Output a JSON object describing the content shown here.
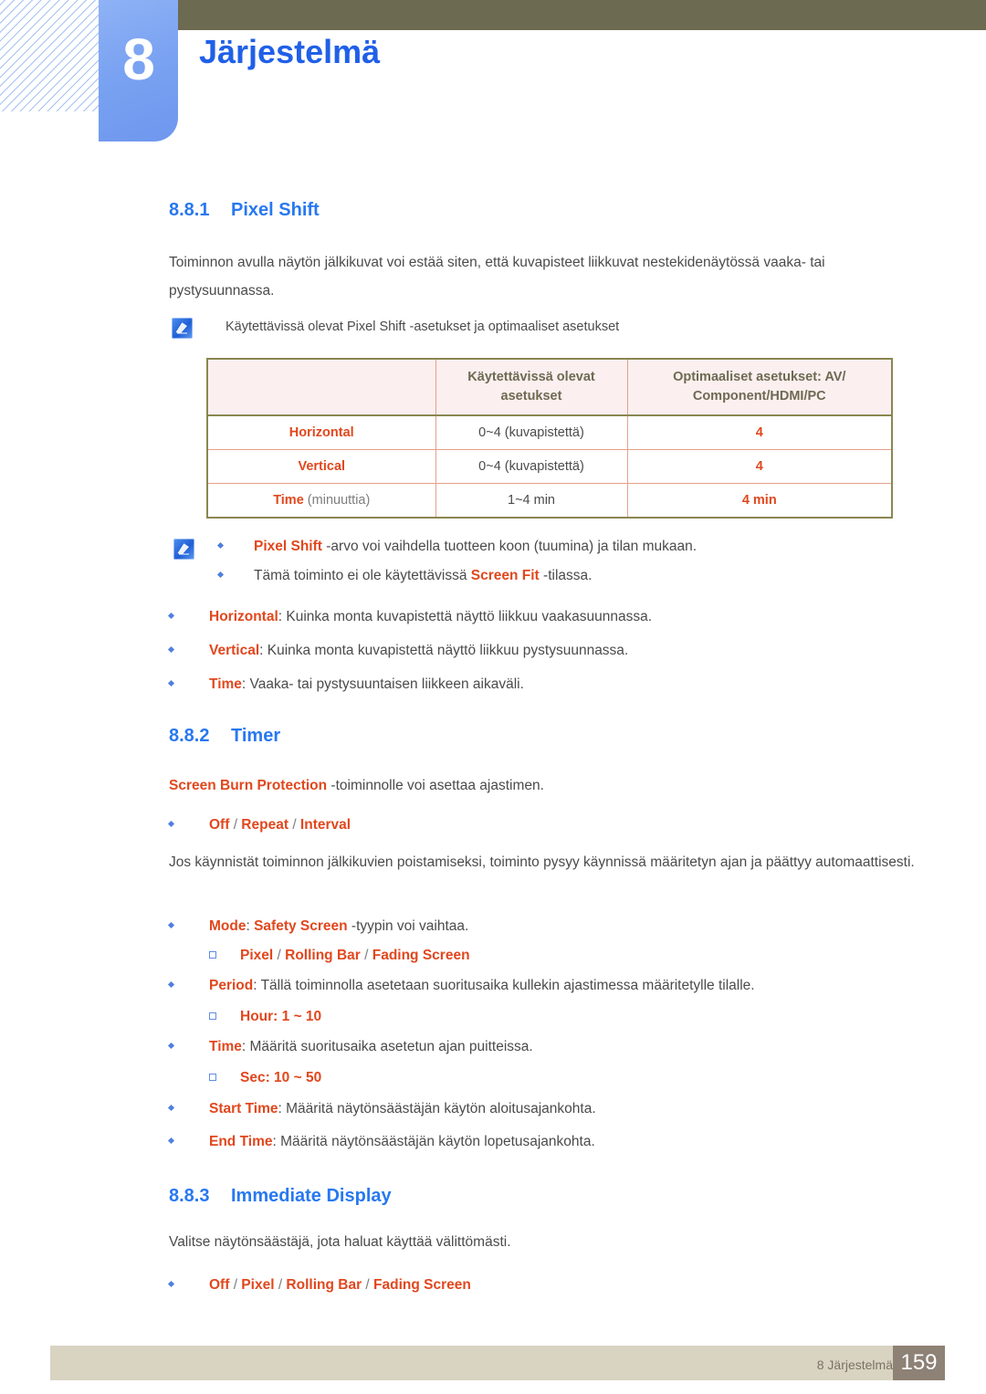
{
  "header": {
    "chapter_number": "8",
    "chapter_title": "Järjestelmä"
  },
  "sections": {
    "s1": {
      "number": "8.8.1",
      "title": "Pixel Shift",
      "body": "Toiminnon avulla näytön jälkikuvat voi estää siten, että kuvapisteet liikkuvat nestekidenäytössä vaaka- tai pystysuunnassa.",
      "note_caption": "Käytettävissä olevat Pixel Shift -asetukset ja optimaaliset asetukset"
    },
    "s2": {
      "number": "8.8.2",
      "title": "Timer",
      "intro_bold": "Screen Burn Protection",
      "intro_rest": " -toiminnolle voi asettaa ajastimen.",
      "options": "Off / Repeat / Interval",
      "body": "Jos käynnistät toiminnon jälkikuvien poistamiseksi, toiminto pysyy käynnissä määritetyn ajan ja päättyy automaattisesti."
    },
    "s3": {
      "number": "8.8.3",
      "title": "Immediate Display",
      "body": "Valitse näytönsäästäjä, jota haluat käyttää välittömästi.",
      "options": "Off / Pixel / Rolling Bar / Fading Screen"
    }
  },
  "table": {
    "columns": [
      "",
      "Käytettävissä olevat asetukset",
      "Optimaaliset asetukset: AV/ Component/HDMI/PC"
    ],
    "col_header_lines": [
      [
        "",
        ""
      ],
      [
        "Käytettävissä olevat",
        "asetukset"
      ],
      [
        "Optimaaliset asetukset: AV/",
        "Component/HDMI/PC"
      ]
    ],
    "rows": [
      {
        "key": "Horizontal",
        "key_unit": "",
        "available": "0~4 (kuvapistettä)",
        "optimal": "4"
      },
      {
        "key": "Vertical",
        "key_unit": "",
        "available": "0~4 (kuvapistettä)",
        "optimal": "4"
      },
      {
        "key": "Time",
        "key_unit": " (minuuttia)",
        "available": "1~4 min",
        "optimal": "4 min"
      }
    ]
  },
  "notes_after_table": {
    "item1_bold": "Pixel Shift",
    "item1_rest": " -arvo voi vaihdella tuotteen koon (tuumina) ja tilan mukaan.",
    "item2_pre": "Tämä toiminto ei ole käytettävissä ",
    "item2_bold": "Screen Fit",
    "item2_rest": " -tilassa."
  },
  "pixel_shift_bullets": [
    {
      "bold": "Horizontal",
      "rest": ": Kuinka monta kuvapistettä näyttö liikkuu vaakasuunnassa."
    },
    {
      "bold": "Vertical",
      "rest": ": Kuinka monta kuvapistettä näyttö liikkuu pystysuunnassa."
    },
    {
      "bold": "Time",
      "rest": ": Vaaka- tai pystysuuntaisen liikkeen aikaväli."
    }
  ],
  "timer_bullets": [
    {
      "bold": "Mode",
      "mid": ": ",
      "bold2": "Safety Screen",
      "rest": " -tyypin voi vaihtaa."
    },
    {
      "bold": "Period",
      "rest": ": Tällä toiminnolla asetetaan suoritusaika kullekin ajastimessa määritetylle tilalle."
    },
    {
      "bold": "Time",
      "rest": ": Määritä suoritusaika asetetun ajan puitteissa."
    },
    {
      "bold": "Start Time",
      "rest": ": Määritä näytönsäästäjän käytön aloitusajankohta."
    },
    {
      "bold": "End Time",
      "rest": ": Määritä näytönsäästäjän käytön lopetusajankohta."
    }
  ],
  "timer_sub_bullets": {
    "mode_options": "Pixel / Rolling Bar / Fading Screen",
    "hour_label": "Hour",
    "hour_value": ": 1 ~ 10",
    "sec_label": "Sec",
    "sec_value": ": 10 ~ 50"
  },
  "footer": {
    "text": "8 Järjestelmä",
    "page": "159"
  },
  "colors": {
    "accent_blue": "#2878f0",
    "accent_orange": "#e1471d",
    "olive": "#6d6a52",
    "table_header_bg": "#fbefef",
    "footer_band": "#d9d3c2",
    "footer_page_bg": "#8e8175"
  }
}
